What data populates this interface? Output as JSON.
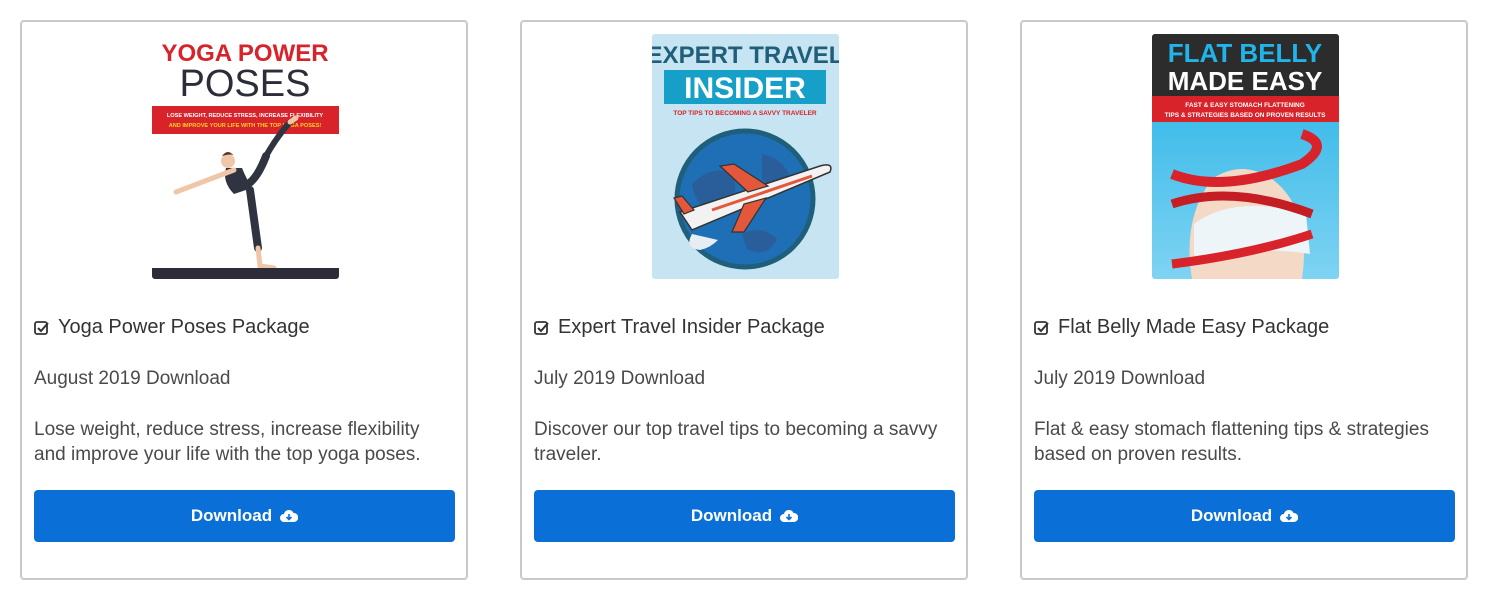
{
  "cards": [
    {
      "title": "Yoga Power Poses Package",
      "date": "August 2019 Download",
      "description": "Lose weight, reduce stress, increase flexibility and improve your life with the top yoga poses.",
      "button": "Download",
      "cover": {
        "line1": "YOGA POWER",
        "line2": "POSES",
        "band1": "LOSE WEIGHT, REDUCE STRESS, INCREASE FLEXIBILITY",
        "band2": "AND IMPROVE YOUR LIFE WITH THE TOP YOGA POSES!"
      }
    },
    {
      "title": "Expert Travel Insider Package",
      "date": "July 2019 Download",
      "description": "Discover our top travel tips to becoming a savvy traveler.",
      "button": "Download",
      "cover": {
        "line1": "EXPERT TRAVEL",
        "line2": "INSIDER",
        "tagline": "TOP TIPS TO BECOMING A SAVVY TRAVELER"
      }
    },
    {
      "title": "Flat Belly Made Easy Package",
      "date": "July 2019 Download",
      "description": "Flat & easy stomach flattening tips & strategies based on proven results.",
      "button": "Download",
      "cover": {
        "line1": "FLAT BELLY",
        "line2": "MADE EASY",
        "band1": "FAST & EASY STOMACH FLATTENING",
        "band2": "TIPS & STRATEGIES BASED ON PROVEN RESULTS"
      }
    }
  ],
  "colors": {
    "button": "#0a6fd6",
    "border": "#c9c9c9"
  },
  "icons": [
    "check-square-icon",
    "cloud-download-icon"
  ]
}
